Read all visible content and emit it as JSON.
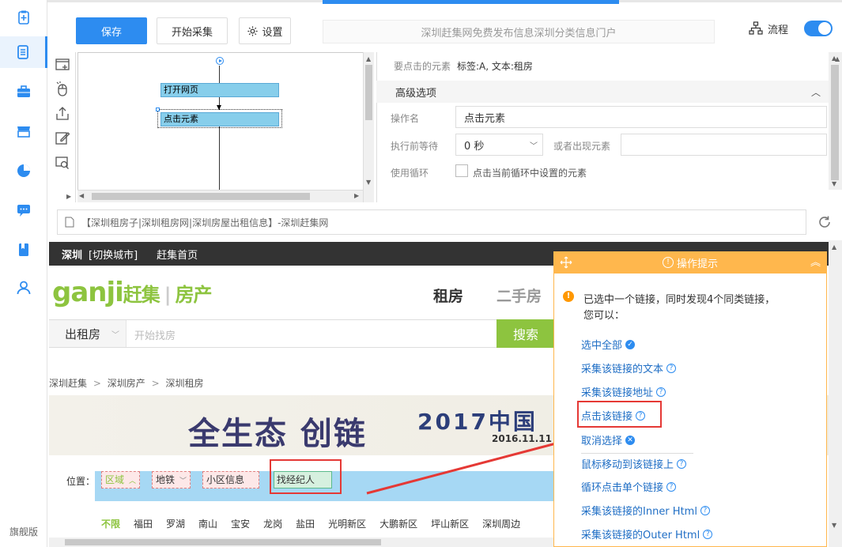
{
  "sidebar": {
    "brand": "旗舰版"
  },
  "toolbar": {
    "save_label": "保存",
    "start_label": "开始采集",
    "settings_label": "设置",
    "page_title": "深圳赶集网免费发布信息深圳分类信息门户",
    "flow_label": "流程"
  },
  "flow": {
    "nodes": [
      "打开网页",
      "点击元素"
    ]
  },
  "props": {
    "target_label": "要点击的元素",
    "target_value": "标签:A, 文本:租房",
    "advanced_label": "高级选项",
    "op_name_label": "操作名",
    "op_name_value": "点击元素",
    "wait_label": "执行前等待",
    "wait_value": "0 秒",
    "or_appear_label": "或者出现元素",
    "loop_label": "使用循环",
    "loop_option": "点击当前循环中设置的元素"
  },
  "address": {
    "value": "【深圳租房子|深圳租房网|深圳房屋出租信息】-深圳赶集网"
  },
  "web": {
    "city": "深圳",
    "switch_city": "[切换城市]",
    "home": "赶集首页",
    "logo_brand": "ganji",
    "logo_cn": "赶集",
    "logo_section": "房产",
    "nav_rent": "租房",
    "nav_second": "二手房",
    "search_category": "出租房",
    "search_placeholder": "开始找房",
    "search_button": "搜索",
    "breadcrumb": [
      "深圳赶集",
      "深圳房产",
      "深圳租房"
    ],
    "banner_text1": "全生态 创链",
    "banner_text2": "2017中国",
    "banner_date": "2016.11.11",
    "filter_label": "位置：",
    "filter_tags": [
      "区域",
      "地铁",
      "小区信息",
      "找经纪人"
    ],
    "districts": [
      "不限",
      "福田",
      "罗湖",
      "南山",
      "宝安",
      "龙岗",
      "盐田",
      "光明新区",
      "大鹏新区",
      "坪山新区",
      "深圳周边"
    ]
  },
  "tips": {
    "title": "操作提示",
    "message_line1": "已选中一个链接，同时发现4个同类链接，",
    "message_line2": "您可以：",
    "links": [
      "选中全部",
      "采集该链接的文本",
      "采集该链接地址",
      "点击该链接",
      "取消选择",
      "鼠标移动到该链接上",
      "循环点击单个链接",
      "采集该链接的Inner Html",
      "采集该链接的Outer Html"
    ]
  },
  "colors": {
    "accent": "#2d8cf0",
    "tips_header": "#ffb74d",
    "search_green": "#8dc43f",
    "highlight_red": "#e53935"
  }
}
